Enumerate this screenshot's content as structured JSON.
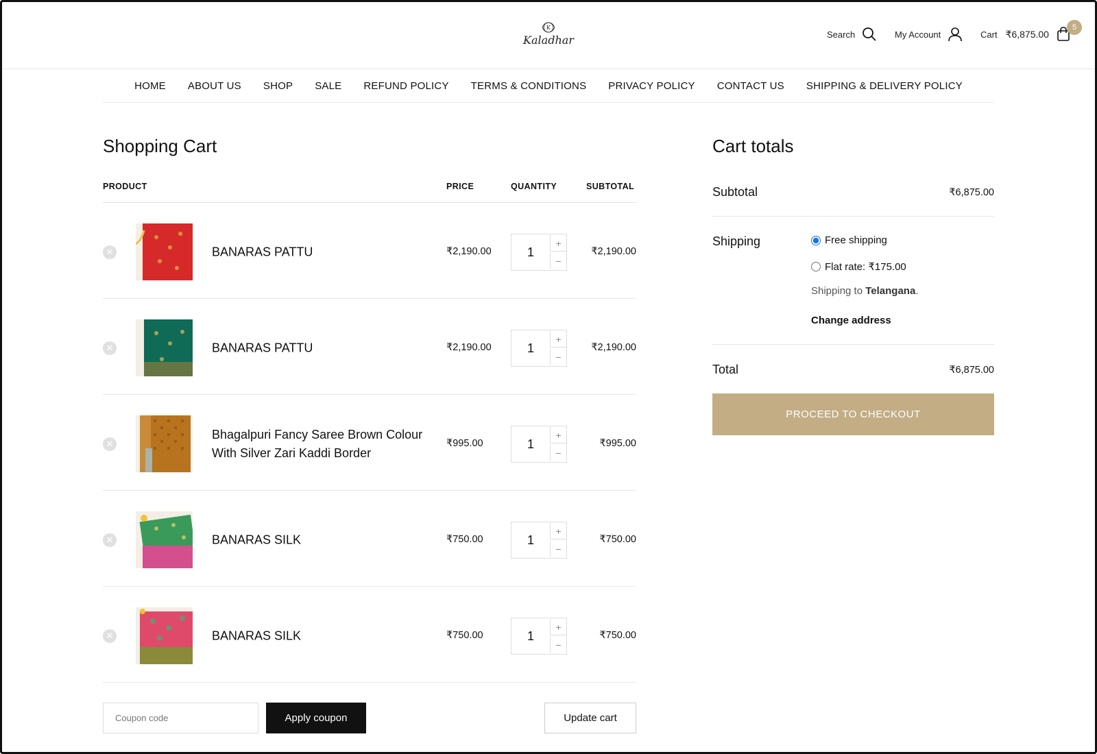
{
  "brand": {
    "name": "Kaladhar",
    "accent": "#c2ad85"
  },
  "header": {
    "search_label": "Search",
    "account_label": "My Account",
    "cart_label": "Cart",
    "cart_amount": "₹6,875.00",
    "cart_count": "5"
  },
  "nav": [
    {
      "label": "HOME"
    },
    {
      "label": "ABOUT US"
    },
    {
      "label": "SHOP"
    },
    {
      "label": "SALE"
    },
    {
      "label": "REFUND POLICY"
    },
    {
      "label": "TERMS & CONDITIONS"
    },
    {
      "label": "PRIVACY POLICY"
    },
    {
      "label": "CONTACT US"
    },
    {
      "label": "SHIPPING & DELIVERY POLICY"
    }
  ],
  "cart": {
    "title": "Shopping Cart",
    "columns": {
      "product": "PRODUCT",
      "price": "PRICE",
      "quantity": "QUANTITY",
      "subtotal": "SUBTOTAL"
    },
    "items": [
      {
        "name": "BANARAS PATTU",
        "price": "₹2,190.00",
        "quantity": "1",
        "subtotal": "₹2,190.00",
        "thumb_color": "#d62a2a"
      },
      {
        "name": "BANARAS PATTU",
        "price": "₹2,190.00",
        "quantity": "1",
        "subtotal": "₹2,190.00",
        "thumb_color": "#0f6b55"
      },
      {
        "name": "Bhagalpuri Fancy Saree Brown Colour With Silver Zari Kaddi Border",
        "price": "₹995.00",
        "quantity": "1",
        "subtotal": "₹995.00",
        "thumb_color": "#b8731e"
      },
      {
        "name": "BANARAS SILK",
        "price": "₹750.00",
        "quantity": "1",
        "subtotal": "₹750.00",
        "thumb_color": "#3a9a5a"
      },
      {
        "name": "BANARAS SILK",
        "price": "₹750.00",
        "quantity": "1",
        "subtotal": "₹750.00",
        "thumb_color": "#e04a6a"
      }
    ],
    "coupon_placeholder": "Coupon code",
    "apply_coupon_label": "Apply coupon",
    "update_cart_label": "Update cart"
  },
  "totals": {
    "title": "Cart totals",
    "subtotal_label": "Subtotal",
    "subtotal_value": "₹6,875.00",
    "shipping_label": "Shipping",
    "shipping_options": [
      {
        "label": "Free shipping",
        "selected": true
      },
      {
        "label": "Flat rate: ₹175.00",
        "selected": false
      }
    ],
    "shipping_to_prefix": "Shipping to ",
    "shipping_to_region": "Telangana",
    "shipping_to_suffix": ".",
    "change_address_label": "Change address",
    "total_label": "Total",
    "total_value": "₹6,875.00",
    "checkout_label": "PROCEED TO CHECKOUT"
  }
}
